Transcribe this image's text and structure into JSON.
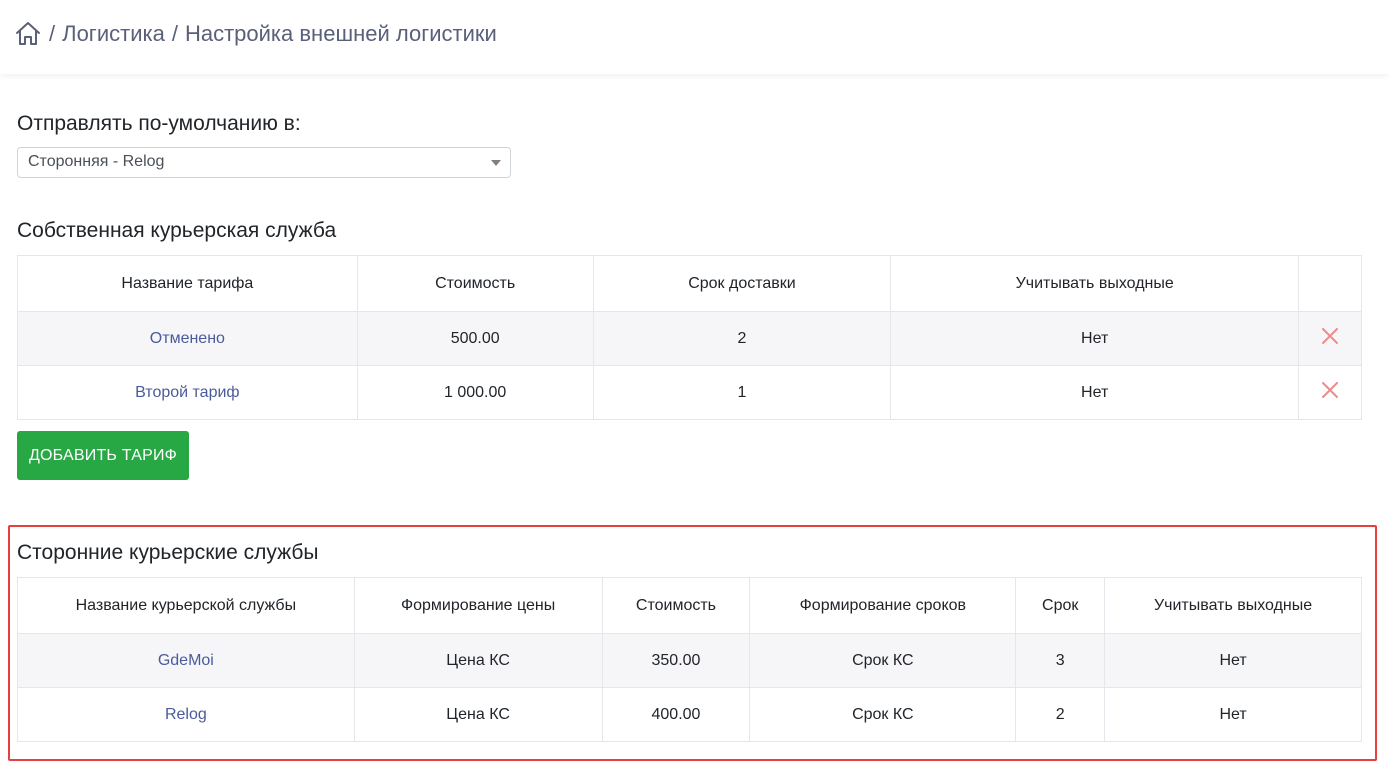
{
  "breadcrumb": {
    "home_icon": "home-icon",
    "items": [
      "Логистика",
      "Настройка внешней логистики"
    ],
    "separator": "/"
  },
  "default_send": {
    "label": "Отправлять по-умолчанию в:",
    "value": "Сторонняя - Relog"
  },
  "own_service": {
    "title": "Собственная курьерская служба",
    "columns": [
      "Название тарифа",
      "Стоимость",
      "Срок доставки",
      "Учитывать выходные",
      ""
    ],
    "rows": [
      {
        "name": "Отменено",
        "cost": "500.00",
        "term": "2",
        "weekends": "Нет"
      },
      {
        "name": "Второй тариф",
        "cost": "1 000.00",
        "term": "1",
        "weekends": "Нет"
      }
    ],
    "add_button": "Добавить тариф",
    "delete_icon": "close-icon",
    "delete_color": "#f08a8a"
  },
  "third_party": {
    "title": "Сторонние курьерские службы",
    "columns": [
      "Название курьерской службы",
      "Формирование цены",
      "Стоимость",
      "Формирование сроков",
      "Срок",
      "Учитывать выходные"
    ],
    "rows": [
      {
        "name": "GdeMoi",
        "price_mode": "Цена КС",
        "cost": "350.00",
        "term_mode": "Срок КС",
        "term": "3",
        "weekends": "Нет"
      },
      {
        "name": "Relog",
        "price_mode": "Цена КС",
        "cost": "400.00",
        "term_mode": "Срок КС",
        "term": "2",
        "weekends": "Нет"
      }
    ]
  },
  "colors": {
    "accent_green": "#28a745",
    "link": "#4a5b9a",
    "highlight_border": "#e53f3f"
  }
}
